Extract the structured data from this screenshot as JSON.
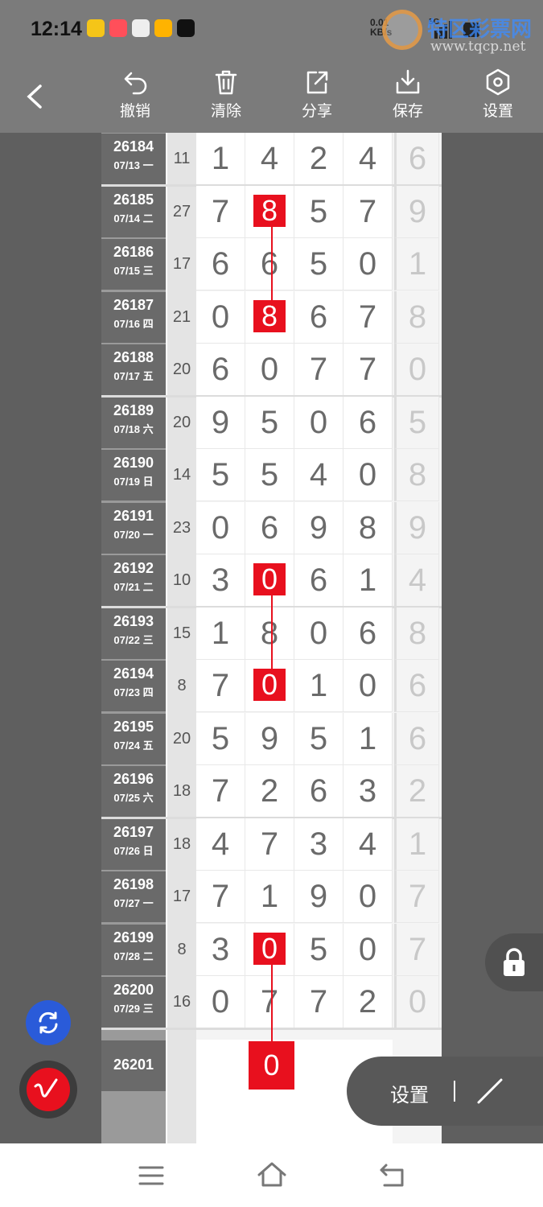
{
  "status": {
    "time": "12:14",
    "net_speed": "0.01\nKB/s",
    "signal": "5G"
  },
  "watermark": {
    "title": "特区彩票网",
    "url": "www.tqcp.net"
  },
  "toolbar": {
    "undo": "撤销",
    "clear": "清除",
    "share": "分享",
    "save": "保存",
    "settings": "设置"
  },
  "rows": [
    {
      "issue": "26184",
      "date": "07/13 一",
      "sum": "11",
      "d": [
        "1",
        "4",
        "2",
        "4"
      ],
      "last": "6"
    },
    {
      "issue": "26185",
      "date": "07/14 二",
      "sum": "27",
      "d": [
        "7",
        "8",
        "5",
        "7"
      ],
      "last": "9"
    },
    {
      "issue": "26186",
      "date": "07/15 三",
      "sum": "17",
      "d": [
        "6",
        "6",
        "5",
        "0"
      ],
      "last": "1"
    },
    {
      "issue": "26187",
      "date": "07/16 四",
      "sum": "21",
      "d": [
        "0",
        "8",
        "6",
        "7"
      ],
      "last": "8"
    },
    {
      "issue": "26188",
      "date": "07/17 五",
      "sum": "20",
      "d": [
        "6",
        "0",
        "7",
        "7"
      ],
      "last": "0"
    },
    {
      "issue": "26189",
      "date": "07/18 六",
      "sum": "20",
      "d": [
        "9",
        "5",
        "0",
        "6"
      ],
      "last": "5"
    },
    {
      "issue": "26190",
      "date": "07/19 日",
      "sum": "14",
      "d": [
        "5",
        "5",
        "4",
        "0"
      ],
      "last": "8"
    },
    {
      "issue": "26191",
      "date": "07/20 一",
      "sum": "23",
      "d": [
        "0",
        "6",
        "9",
        "8"
      ],
      "last": "9"
    },
    {
      "issue": "26192",
      "date": "07/21 二",
      "sum": "10",
      "d": [
        "3",
        "0",
        "6",
        "1"
      ],
      "last": "4"
    },
    {
      "issue": "26193",
      "date": "07/22 三",
      "sum": "15",
      "d": [
        "1",
        "8",
        "0",
        "6"
      ],
      "last": "8"
    },
    {
      "issue": "26194",
      "date": "07/23 四",
      "sum": "8",
      "d": [
        "7",
        "0",
        "1",
        "0"
      ],
      "last": "6"
    },
    {
      "issue": "26195",
      "date": "07/24 五",
      "sum": "20",
      "d": [
        "5",
        "9",
        "5",
        "1"
      ],
      "last": "6"
    },
    {
      "issue": "26196",
      "date": "07/25 六",
      "sum": "18",
      "d": [
        "7",
        "2",
        "6",
        "3"
      ],
      "last": "2"
    },
    {
      "issue": "26197",
      "date": "07/26 日",
      "sum": "18",
      "d": [
        "4",
        "7",
        "3",
        "4"
      ],
      "last": "1"
    },
    {
      "issue": "26198",
      "date": "07/27 一",
      "sum": "17",
      "d": [
        "7",
        "1",
        "9",
        "0"
      ],
      "last": "7"
    },
    {
      "issue": "26199",
      "date": "07/28 二",
      "sum": "8",
      "d": [
        "3",
        "0",
        "5",
        "0"
      ],
      "last": "7"
    },
    {
      "issue": "26200",
      "date": "07/29 三",
      "sum": "16",
      "d": [
        "0",
        "7",
        "7",
        "2"
      ],
      "last": "0"
    }
  ],
  "highlights": [
    [
      1,
      1
    ],
    [
      3,
      1
    ],
    [
      8,
      1
    ],
    [
      10,
      1
    ],
    [
      15,
      1
    ]
  ],
  "prediction": {
    "issue": "26201",
    "value": "0"
  },
  "floating": {
    "settings_label": "设置"
  },
  "colors": {
    "accent_red": "#e8101e",
    "sync_blue": "#2a5bd9"
  }
}
